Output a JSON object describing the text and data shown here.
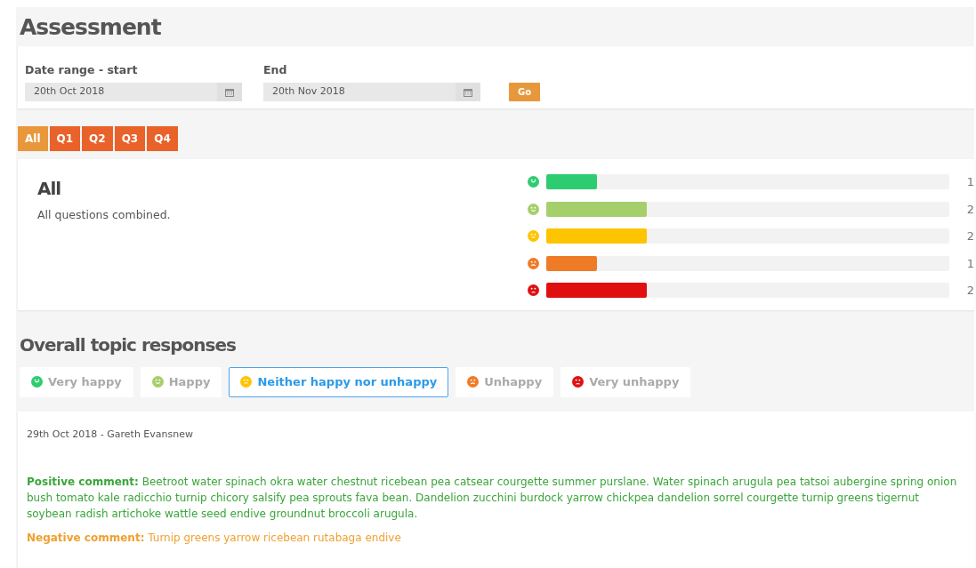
{
  "title": "Assessment",
  "date_range": {
    "start_label": "Date range - start",
    "start_value": "20th Oct 2018",
    "end_label": "End",
    "end_value": "20th Nov 2018",
    "go_button": "Go"
  },
  "quarter_tabs": [
    {
      "label": "All",
      "selected": true
    },
    {
      "label": "Q1",
      "selected": false
    },
    {
      "label": "Q2",
      "selected": false
    },
    {
      "label": "Q3",
      "selected": false
    },
    {
      "label": "Q4",
      "selected": false
    }
  ],
  "summary": {
    "heading": "All",
    "description": "All questions combined.",
    "bars": [
      {
        "kind": "very_happy",
        "color": "#2ecc71",
        "level": 0.125,
        "count": "1"
      },
      {
        "kind": "happy",
        "color": "#a5cf6b",
        "level": 0.25,
        "count": "2"
      },
      {
        "kind": "neutral",
        "color": "#ffc400",
        "level": 0.25,
        "count": "2"
      },
      {
        "kind": "unhappy",
        "color": "#f07b27",
        "level": 0.125,
        "count": "1"
      },
      {
        "kind": "very_unhappy",
        "color": "#e01010",
        "level": 0.25,
        "count": "2"
      }
    ]
  },
  "topic_heading": "Overall topic responses",
  "topic_filters": [
    {
      "kind": "very_happy",
      "color": "#2ecc71",
      "label": "Very happy",
      "selected": false
    },
    {
      "kind": "happy",
      "color": "#a5cf6b",
      "label": "Happy",
      "selected": false
    },
    {
      "kind": "neutral",
      "color": "#ffc400",
      "label": "Neither happy nor unhappy",
      "selected": true
    },
    {
      "kind": "unhappy",
      "color": "#f07b27",
      "label": "Unhappy",
      "selected": false
    },
    {
      "kind": "very_unhappy",
      "color": "#e01010",
      "label": "Very unhappy",
      "selected": false
    }
  ],
  "responses": [
    {
      "meta": "29th Oct 2018 - Gareth Evansnew",
      "positive": "**Positive comment:** Beetroot water spinach okra water chestnut ricebean pea catsear courgette summer purslane. Water spinach arugula pea tatsoi aubergine spring onion bush tomato kale radicchio turnip chicory salsify pea sprouts fava bean. Dandelion zucchini burdock yarrow chickpea dandelion sorrel courgette turnip greens tigernut soybean radish artichoke wattle seed endive groundnut broccoli arugula.",
      "negative": "**Negative comment:** Turnip greens yarrow ricebean rutabaga endive"
    }
  ]
}
